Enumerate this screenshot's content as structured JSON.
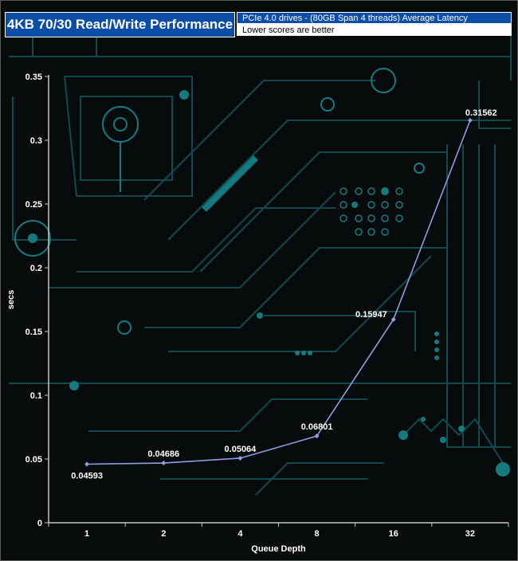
{
  "header": {
    "title": "4KB 70/30 Read/Write Performance",
    "subtitle_line1": "PCIe 4.0 drives - (80GB Span 4 threads) Average Latency",
    "subtitle_line2": "Lower scores are better"
  },
  "colors": {
    "background": "#080b0b",
    "circuit": "#0e4a4f",
    "circuit_bright": "#157a80",
    "axis": "#c8c8c8",
    "series_line": "#8c9ce6",
    "header_blue": "#0c4da8"
  },
  "chart_data": {
    "type": "line",
    "title": "4KB 70/30 Read/Write Performance",
    "xlabel": "Queue Depth",
    "ylabel": "secs",
    "categories": [
      "1",
      "2",
      "4",
      "8",
      "16",
      "32"
    ],
    "series": [
      {
        "values": [
          0.04593,
          0.04686,
          0.05064,
          0.06801,
          0.15947,
          0.31562
        ]
      }
    ],
    "data_labels": [
      "0.04593",
      "0.04686",
      "0.05064",
      "0.06801",
      "0.15947",
      "0.31562"
    ],
    "ylim": [
      0,
      0.35
    ],
    "yticks": [
      0,
      0.05,
      0.1,
      0.15,
      0.2,
      0.25,
      0.3,
      0.35
    ],
    "ytick_labels": [
      "0",
      "0.05",
      "0.1",
      "0.15",
      "0.2",
      "0.25",
      "0.3",
      "0.35"
    ],
    "grid": false,
    "legend": "none"
  }
}
